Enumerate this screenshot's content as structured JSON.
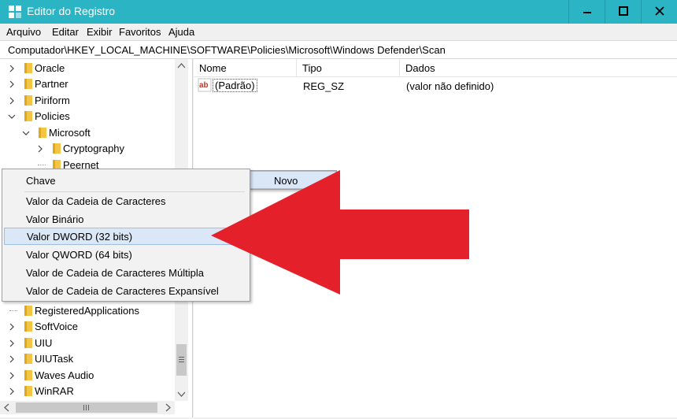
{
  "window": {
    "title": "Editor do Registro",
    "accent_color": "#2bb5c4"
  },
  "menubar": {
    "items": [
      "Arquivo",
      "Editar",
      "Exibir",
      "Favoritos",
      "Ajuda"
    ]
  },
  "address_bar": {
    "path": "Computador\\HKEY_LOCAL_MACHINE\\SOFTWARE\\Policies\\Microsoft\\Windows Defender\\Scan"
  },
  "tree": {
    "items": [
      {
        "label": "Oracle",
        "expand": "collapsed"
      },
      {
        "label": "Partner",
        "expand": "collapsed"
      },
      {
        "label": "Piriform",
        "expand": "collapsed"
      },
      {
        "label": "Policies",
        "expand": "expanded"
      },
      {
        "label": "Microsoft",
        "expand": "expanded"
      },
      {
        "label": "Cryptography",
        "expand": "collapsed"
      },
      {
        "label": "Peernet",
        "expand": "none"
      },
      {
        "label": "RegisteredApplications",
        "expand": "none"
      },
      {
        "label": "SoftVoice",
        "expand": "collapsed"
      },
      {
        "label": "UIU",
        "expand": "collapsed"
      },
      {
        "label": "UIUTask",
        "expand": "collapsed"
      },
      {
        "label": "Waves Audio",
        "expand": "collapsed"
      },
      {
        "label": "WinRAR",
        "expand": "collapsed"
      }
    ]
  },
  "list": {
    "columns": [
      "Nome",
      "Tipo",
      "Dados"
    ],
    "rows": [
      {
        "name": "(Padrão)",
        "type": "REG_SZ",
        "data": "(valor não definido)",
        "icon": "string-value-icon"
      }
    ]
  },
  "context_menu": {
    "novo_label": "Novo",
    "submenu_arrow": "›"
  },
  "submenu": {
    "items": [
      "Chave",
      "Valor da Cadeia de Caracteres",
      "Valor Binário",
      "Valor DWORD (32 bits)",
      "Valor QWORD (64 bits)",
      "Valor de Cadeia de Caracteres Múltipla",
      "Valor de Cadeia de Caracteres Expansível"
    ],
    "highlighted_index": 3
  },
  "annotation": {
    "arrow_color": "#e4202a"
  }
}
